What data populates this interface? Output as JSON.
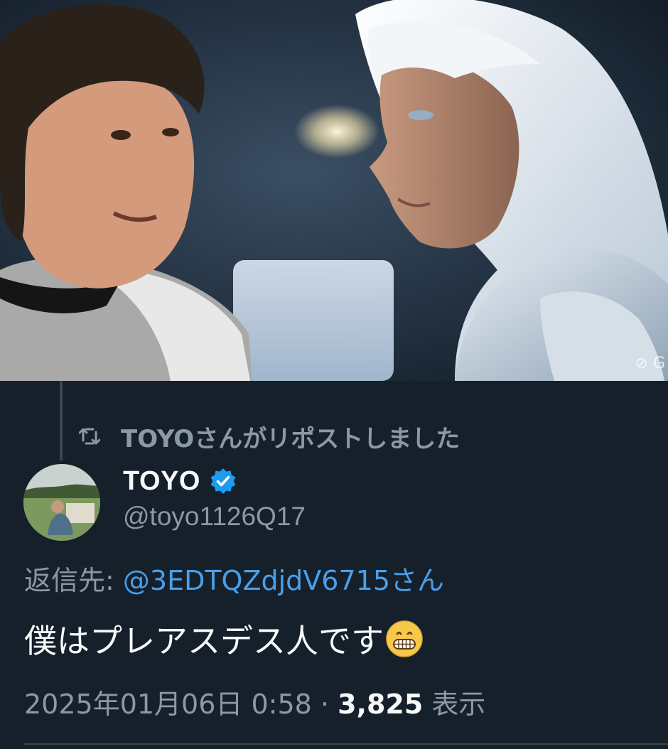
{
  "media": {
    "watermark": "⊘ G"
  },
  "repost": {
    "icon": "repost-icon",
    "text": "TOYOさんがリポストしました"
  },
  "author": {
    "display_name": "TOYO",
    "verified_icon": "verified-badge-icon",
    "handle": "@toyo1126Q17"
  },
  "reply": {
    "label": "返信先: ",
    "mention": "@3EDTQZdjdV6715さん"
  },
  "tweet": {
    "text": "僕はプレアスデス人です",
    "emoji": "grinning-face-emoji"
  },
  "meta": {
    "timestamp": "2025年01月06日 0:58 · ",
    "views_count": "3,825",
    "views_label": " 表示"
  },
  "colors": {
    "background": "#15202b",
    "secondary_text": "#8b98a5",
    "primary_text": "#f7f9f9",
    "link": "#4a9fe8",
    "verified": "#1d9bf0"
  }
}
